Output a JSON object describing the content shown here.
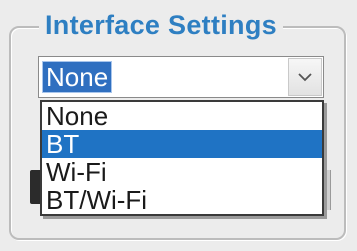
{
  "group": {
    "title": "Interface Settings"
  },
  "combo": {
    "value": "None",
    "button_icon": "chevron-down-icon"
  },
  "dropdown": {
    "options": [
      {
        "label": "None",
        "selected": false
      },
      {
        "label": "BT",
        "selected": true
      },
      {
        "label": "Wi-Fi",
        "selected": false
      },
      {
        "label": "BT/Wi-Fi",
        "selected": false
      }
    ]
  },
  "colors": {
    "title": "#2e7fc2",
    "selection": "#1f73c4",
    "background": "#ececec"
  }
}
